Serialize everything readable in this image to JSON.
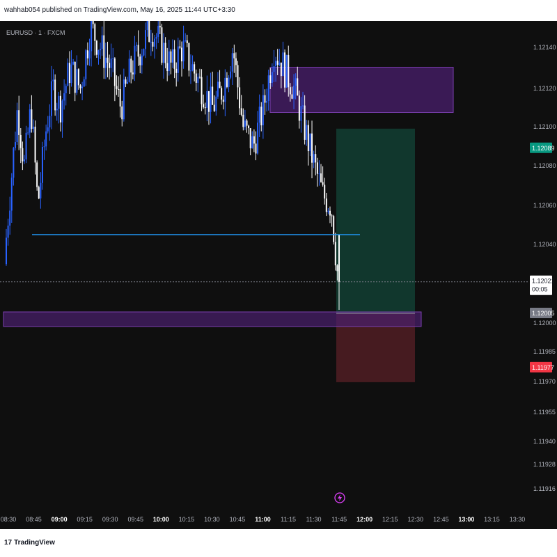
{
  "header": {
    "text": "wahhab054 published on TradingView.com, May 16, 2025 11:44 UTC+3:30"
  },
  "symbol": {
    "text": "EURUSD · 1 · FXCM"
  },
  "footer": {
    "logo_mark": "17",
    "logo_text": "TradingView"
  },
  "icons": {
    "flash": "lightning-icon"
  },
  "colors": {
    "background": "#0f0f0f",
    "bull_candle": "#2962ff",
    "bear_candle": "#ffffff",
    "support_line": "#2196f3",
    "zone_fill": "#4a1f6e",
    "zone_border": "#7b3fb0",
    "target_fill": "#123a2f",
    "stop_fill": "#4a1c22",
    "price_tag_target": "#089981",
    "price_tag_stop": "#f23645",
    "price_tag_current": "#ffffff",
    "price_tag_entry": "#787b86"
  },
  "chart_data": {
    "type": "candlestick",
    "title": "EURUSD · 1 · FXCM",
    "xlabel": "",
    "ylabel": "",
    "grid": false,
    "x_ticks": [
      "08:30",
      "08:45",
      "09:00",
      "09:15",
      "09:30",
      "09:45",
      "10:00",
      "10:15",
      "10:30",
      "10:45",
      "11:00",
      "11:15",
      "11:30",
      "11:45",
      "12:00",
      "12:15",
      "12:30",
      "12:45",
      "13:00",
      "13:15",
      "13:30"
    ],
    "bold_x_ticks": [
      "09:00",
      "10:00",
      "11:00",
      "12:00",
      "13:00"
    ],
    "y_ticks": [
      1.1214,
      1.1212,
      1.121,
      1.1208,
      1.1206,
      1.1204,
      1.12,
      1.11985,
      1.1197,
      1.11955,
      1.1194,
      1.11928,
      1.11916
    ],
    "y_tick_labels": [
      "1.12140",
      "1.12120",
      "1.12100",
      "1.12080",
      "1.12060",
      "1.12040",
      "1.12000",
      "1.11985",
      "1.11970",
      "1.11955",
      "1.11940",
      "1.11928",
      "1.11916"
    ],
    "price_path": [
      {
        "t": "08:27",
        "price": 1.1203
      },
      {
        "t": "08:31",
        "price": 1.1207
      },
      {
        "t": "08:35",
        "price": 1.1211
      },
      {
        "t": "08:39",
        "price": 1.1208
      },
      {
        "t": "08:43",
        "price": 1.1211
      },
      {
        "t": "08:47",
        "price": 1.1206
      },
      {
        "t": "08:52",
        "price": 1.121
      },
      {
        "t": "08:56",
        "price": 1.1212
      },
      {
        "t": "09:00",
        "price": 1.1211
      },
      {
        "t": "09:06",
        "price": 1.1213
      },
      {
        "t": "09:12",
        "price": 1.1212
      },
      {
        "t": "09:18",
        "price": 1.1215
      },
      {
        "t": "09:24",
        "price": 1.1214
      },
      {
        "t": "09:30",
        "price": 1.1213
      },
      {
        "t": "09:36",
        "price": 1.1211
      },
      {
        "t": "09:42",
        "price": 1.1213
      },
      {
        "t": "09:48",
        "price": 1.1214
      },
      {
        "t": "09:54",
        "price": 1.1215
      },
      {
        "t": "10:00",
        "price": 1.1214
      },
      {
        "t": "10:06",
        "price": 1.1213
      },
      {
        "t": "10:12",
        "price": 1.1214
      },
      {
        "t": "10:18",
        "price": 1.1213
      },
      {
        "t": "10:24",
        "price": 1.1212
      },
      {
        "t": "10:30",
        "price": 1.1211
      },
      {
        "t": "10:36",
        "price": 1.1212
      },
      {
        "t": "10:42",
        "price": 1.1214
      },
      {
        "t": "10:48",
        "price": 1.121
      },
      {
        "t": "10:54",
        "price": 1.1209
      },
      {
        "t": "11:00",
        "price": 1.1211
      },
      {
        "t": "11:06",
        "price": 1.1214
      },
      {
        "t": "11:12",
        "price": 1.1213
      },
      {
        "t": "11:18",
        "price": 1.1212
      },
      {
        "t": "11:24",
        "price": 1.121
      },
      {
        "t": "11:30",
        "price": 1.1208
      },
      {
        "t": "11:35",
        "price": 1.12065
      },
      {
        "t": "11:40",
        "price": 1.1206
      },
      {
        "t": "11:44",
        "price": 1.12021
      }
    ],
    "support_level": 1.12045,
    "last_price": 1.12021,
    "last_price_label": "1.12021",
    "countdown": "00:05",
    "entry_price": 1.12005,
    "entry_label": "1.12005",
    "target_price": 1.12089,
    "target_label": "1.12089",
    "stop_price": 1.11977,
    "stop_label": "1.11977",
    "zones": [
      {
        "name": "supply-zone",
        "price_top": 1.1213,
        "price_bottom": 1.1211
      },
      {
        "name": "demand-zone",
        "price_top": 1.12008,
        "price_bottom": 1.11995
      }
    ]
  }
}
